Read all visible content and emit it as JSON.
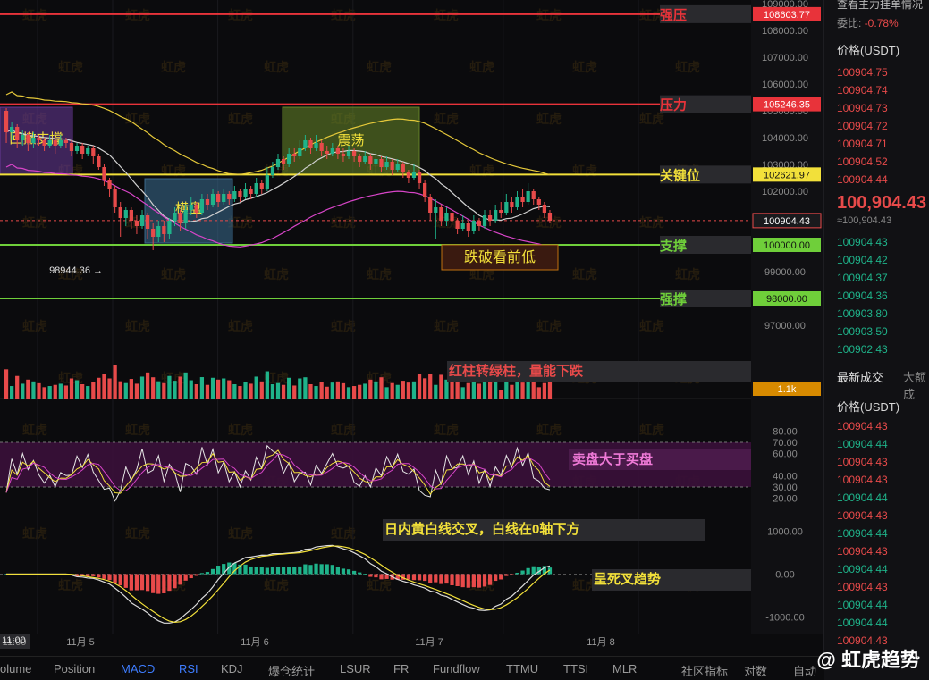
{
  "chart_data": {
    "type": "candlestick",
    "price_axis": {
      "range": [
        96400,
        109000
      ],
      "ticks": [
        "109000.00",
        "108000.00",
        "107000.00",
        "106000.00",
        "105000.00",
        "104000.00",
        "103000.00",
        "102000.00",
        "99000.00",
        "97000.00"
      ]
    },
    "time_axis": [
      "11:00",
      "11月 5",
      "11月 6",
      "11月 7",
      "11月 8"
    ],
    "candles": [
      [
        105000,
        104200,
        105100,
        103800
      ],
      [
        104200,
        104400,
        104600,
        103900
      ],
      [
        104400,
        103900,
        104500,
        103600
      ],
      [
        103900,
        104100,
        104300,
        103700
      ],
      [
        104100,
        103800,
        104200,
        103500
      ],
      [
        103800,
        104000,
        104200,
        103600
      ],
      [
        104000,
        103900,
        104100,
        103700
      ],
      [
        103900,
        103700,
        104000,
        103500
      ],
      [
        103700,
        103900,
        104100,
        103600
      ],
      [
        103900,
        103700,
        104000,
        103400
      ],
      [
        103700,
        103900,
        104100,
        103600
      ],
      [
        103900,
        103800,
        104000,
        103600
      ],
      [
        103800,
        103500,
        103900,
        103300
      ],
      [
        103500,
        103700,
        103800,
        103400
      ],
      [
        103700,
        103400,
        103800,
        103200
      ],
      [
        103400,
        103600,
        103700,
        103300
      ],
      [
        103600,
        103300,
        103700,
        103000
      ],
      [
        103300,
        102900,
        103400,
        102800
      ],
      [
        102900,
        102400,
        103000,
        102200
      ],
      [
        102400,
        102100,
        102500,
        101800
      ],
      [
        102100,
        101400,
        102200,
        101200
      ],
      [
        101400,
        101000,
        101600,
        100300
      ],
      [
        101000,
        101300,
        101400,
        100700
      ],
      [
        101300,
        100900,
        101400,
        100600
      ],
      [
        100900,
        100700,
        101100,
        100400
      ],
      [
        100700,
        101100,
        101300,
        100600
      ],
      [
        101100,
        100600,
        101200,
        100200
      ],
      [
        100600,
        100300,
        100800,
        99800
      ],
      [
        100300,
        100700,
        100900,
        100100
      ],
      [
        100700,
        100400,
        100900,
        100100
      ],
      [
        100400,
        100900,
        101000,
        100200
      ],
      [
        100900,
        101200,
        101400,
        100700
      ],
      [
        101200,
        100800,
        101300,
        100500
      ],
      [
        100800,
        101300,
        101500,
        100600
      ],
      [
        101300,
        101500,
        101800,
        101100
      ],
      [
        101500,
        101200,
        101600,
        101000
      ],
      [
        101200,
        101700,
        101900,
        101100
      ],
      [
        101700,
        101500,
        101900,
        101300
      ],
      [
        101500,
        101900,
        102100,
        101400
      ],
      [
        101900,
        101600,
        102000,
        101400
      ],
      [
        101600,
        101900,
        102100,
        101500
      ],
      [
        101900,
        101700,
        102000,
        101500
      ],
      [
        101700,
        102000,
        102200,
        101600
      ],
      [
        102000,
        101800,
        102100,
        101600
      ],
      [
        101800,
        102100,
        102300,
        101700
      ],
      [
        102100,
        101900,
        102200,
        101700
      ],
      [
        101900,
        102300,
        102500,
        101800
      ],
      [
        102300,
        102100,
        102400,
        101900
      ],
      [
        102100,
        102600,
        102900,
        102000
      ],
      [
        102600,
        102900,
        103100,
        102500
      ],
      [
        102900,
        103200,
        103400,
        102800
      ],
      [
        103200,
        103000,
        103300,
        102800
      ],
      [
        103000,
        103400,
        103600,
        102900
      ],
      [
        103400,
        103300,
        103600,
        103100
      ],
      [
        103300,
        103600,
        103900,
        103200
      ],
      [
        103600,
        103900,
        104100,
        103500
      ],
      [
        103900,
        103600,
        104000,
        103400
      ],
      [
        103600,
        103800,
        104100,
        103500
      ],
      [
        103800,
        103500,
        103900,
        103300
      ],
      [
        103500,
        103400,
        103700,
        103200
      ],
      [
        103400,
        103600,
        103800,
        103300
      ],
      [
        103600,
        103400,
        103700,
        103200
      ],
      [
        103400,
        103300,
        103600,
        103100
      ],
      [
        103300,
        103500,
        103700,
        103200
      ],
      [
        103500,
        103300,
        103600,
        103100
      ],
      [
        103300,
        103100,
        103400,
        102900
      ],
      [
        103100,
        103300,
        103500,
        103000
      ],
      [
        103300,
        103000,
        103400,
        102800
      ],
      [
        103000,
        103200,
        103500,
        102900
      ],
      [
        103200,
        102900,
        103300,
        102700
      ],
      [
        102900,
        103100,
        103300,
        102800
      ],
      [
        103100,
        102800,
        103200,
        102600
      ],
      [
        102800,
        103000,
        103200,
        102700
      ],
      [
        103000,
        102700,
        103100,
        102500
      ],
      [
        102700,
        102500,
        102800,
        102300
      ],
      [
        102500,
        102700,
        103000,
        102400
      ],
      [
        102700,
        102300,
        102800,
        102100
      ],
      [
        102300,
        101800,
        102400,
        101600
      ],
      [
        101800,
        101200,
        101900,
        100900
      ],
      [
        101200,
        101400,
        101700,
        100200
      ],
      [
        101400,
        100900,
        101500,
        100700
      ],
      [
        100900,
        101200,
        101400,
        100700
      ],
      [
        101200,
        100900,
        101300,
        100600
      ],
      [
        100900,
        100600,
        101000,
        100400
      ],
      [
        100600,
        100800,
        101100,
        100500
      ],
      [
        100800,
        100500,
        100900,
        100300
      ],
      [
        100500,
        100900,
        101100,
        100400
      ],
      [
        100900,
        100700,
        101000,
        100500
      ],
      [
        100700,
        101100,
        101300,
        100600
      ],
      [
        101100,
        100900,
        101300,
        100700
      ],
      [
        100900,
        101300,
        101500,
        100800
      ],
      [
        101300,
        101200,
        101600,
        101000
      ],
      [
        101200,
        101600,
        101900,
        101100
      ],
      [
        101600,
        101400,
        101800,
        101200
      ],
      [
        101400,
        101800,
        102000,
        101300
      ],
      [
        101800,
        101600,
        102100,
        101400
      ],
      [
        101600,
        102000,
        102300,
        101500
      ],
      [
        102000,
        101700,
        102100,
        101500
      ],
      [
        101700,
        101500,
        101800,
        101300
      ],
      [
        101500,
        101200,
        101600,
        101000
      ],
      [
        101200,
        100900,
        101300,
        100800
      ]
    ],
    "horizontal_levels": [
      {
        "name": "强压",
        "price": "108603.77",
        "color": "#e8333a"
      },
      {
        "name": "压力",
        "price": "105246.35",
        "color": "#e8333a"
      },
      {
        "name": "关键位",
        "price": "102621.97",
        "color": "#f2e03a"
      },
      {
        "name": "支撑",
        "price": "100000.00",
        "color": "#6fcf3a"
      },
      {
        "name": "强撑",
        "price": "98000.00",
        "color": "#6fcf3a"
      }
    ],
    "current_price": "100904.43",
    "price_axis_labels": [
      "99000.00",
      "97000.00"
    ],
    "low_marker": "98944.36",
    "zones": [
      {
        "label": "回撤支撑",
        "color": "#6a3a9a"
      },
      {
        "label": "横盘",
        "color": "#3d6f93"
      },
      {
        "label": "震荡",
        "color": "#6a8a2a"
      }
    ],
    "annotations": {
      "breakdown": "跌破看前低",
      "volume": "红柱转绿柱，量能下跌",
      "rsi": "卖盘大于买盘",
      "macd_line": "日内黄白线交叉，白线在0轴下方",
      "macd_trend": "呈死叉趋势"
    },
    "volume_panel": {
      "last": "1.1k"
    },
    "rsi_panel": {
      "ticks": [
        "80.00",
        "70.00",
        "60.00",
        "40.00",
        "30.00",
        "20.00"
      ]
    },
    "macd_panel": {
      "ticks": [
        "1000.00",
        "0.00",
        "-1000.00"
      ]
    }
  },
  "orderbook": {
    "title_partial": "查看主力挂单情况",
    "change_label": "委比:",
    "change_value": "-0.78%",
    "price_header": "价格(USDT)",
    "asks": [
      "100904.75",
      "100904.74",
      "100904.73",
      "100904.72",
      "100904.71",
      "100904.52",
      "100904.44"
    ],
    "last_price": "100,904.43",
    "last_price_sub": "≈100,904.43",
    "bids": [
      "100904.43",
      "100904.42",
      "100904.37",
      "100904.36",
      "100903.80",
      "100903.50",
      "100902.43"
    ],
    "trades_tab": "最新成交",
    "trades_tab2": "大额成",
    "trades_header": "价格(USDT)",
    "trades": [
      {
        "p": "100904.43",
        "c": "red"
      },
      {
        "p": "100904.44",
        "c": "green"
      },
      {
        "p": "100904.43",
        "c": "red"
      },
      {
        "p": "100904.43",
        "c": "red"
      },
      {
        "p": "100904.44",
        "c": "green"
      },
      {
        "p": "100904.43",
        "c": "red"
      },
      {
        "p": "100904.44",
        "c": "green"
      },
      {
        "p": "100904.43",
        "c": "red"
      },
      {
        "p": "100904.44",
        "c": "green"
      },
      {
        "p": "100904.43",
        "c": "red"
      },
      {
        "p": "100904.44",
        "c": "green"
      },
      {
        "p": "100904.44",
        "c": "green"
      },
      {
        "p": "100904.43",
        "c": "red"
      }
    ]
  },
  "tabs": [
    "olume",
    "Position",
    "MACD",
    "RSI",
    "KDJ",
    "爆仓统计",
    "LSUR",
    "FR",
    "Fundflow",
    "TTMU",
    "TTSI",
    "MLR",
    "社区指标",
    "对数",
    "自动"
  ],
  "tabs_active": [
    "MACD",
    "RSI"
  ],
  "corner_label": "11:00",
  "watermark_text": "虹虎",
  "brand": "@ 虹虎趋势",
  "colors": {
    "up": "#1fb38a",
    "down": "#e84a4a",
    "yellow": "#f2e03a",
    "white": "#dcdcdc",
    "pink": "#e050c8"
  }
}
